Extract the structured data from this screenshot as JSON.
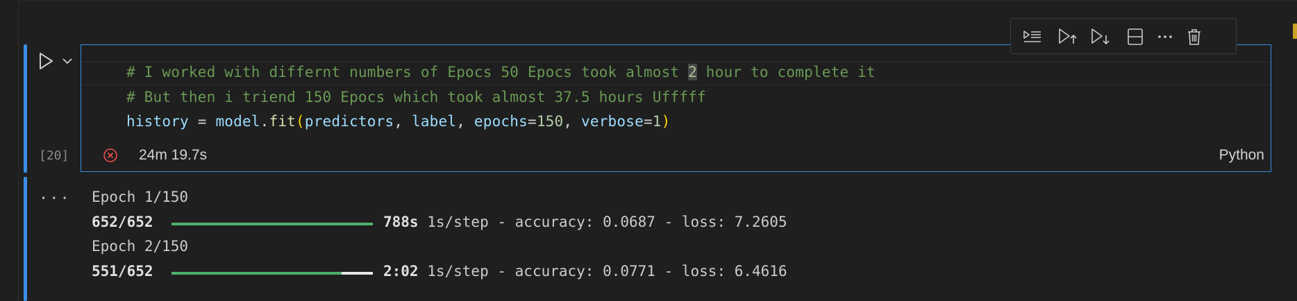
{
  "cell": {
    "execution_count": "[20]",
    "code_lines": {
      "line1_before": "# I worked with differnt numbers of Epocs 50 Epocs took almost ",
      "line1_cursor": "2",
      "line1_after": " hour to complete it",
      "line2": "# But then i triend 150 Epocs which took almost 37.5 hours Ufffff",
      "line3": {
        "var": "history",
        "eq": " = ",
        "obj": "model",
        "dot": ".",
        "fn": "fit",
        "open": "(",
        "arg1": "predictors",
        "comma1": ", ",
        "arg2": "label",
        "comma2": ", ",
        "kw1": "epochs",
        "eq1": "=",
        "val1": "150",
        "comma3": ", ",
        "kw2": "verbose",
        "eq2": "=",
        "val2": "1",
        "close": ")"
      }
    },
    "status": {
      "duration": "24m 19.7s",
      "language": "Python",
      "state_icon": "error-circle-icon"
    }
  },
  "toolbar": {
    "icons": [
      "run-by-line-icon",
      "execute-above-icon",
      "execute-below-icon",
      "split-cell-icon",
      "more-icon",
      "delete-icon"
    ]
  },
  "output": {
    "more_label": "···",
    "epoch1": {
      "header": "Epoch 1/150",
      "steps": "652/652",
      "progress": 1.0,
      "time": "788s",
      "rest": " 1s/step - accuracy: 0.0687 - loss: 7.2605"
    },
    "epoch2": {
      "header": "Epoch 2/150",
      "steps": "551/652",
      "progress": 0.845,
      "time": "2:02",
      "rest": " 1s/step - accuracy: 0.0771 - loss: 6.4616"
    }
  },
  "colors": {
    "accent": "#3a8ee6",
    "progress_fill": "#4fb06e",
    "error": "#f14c4c"
  }
}
